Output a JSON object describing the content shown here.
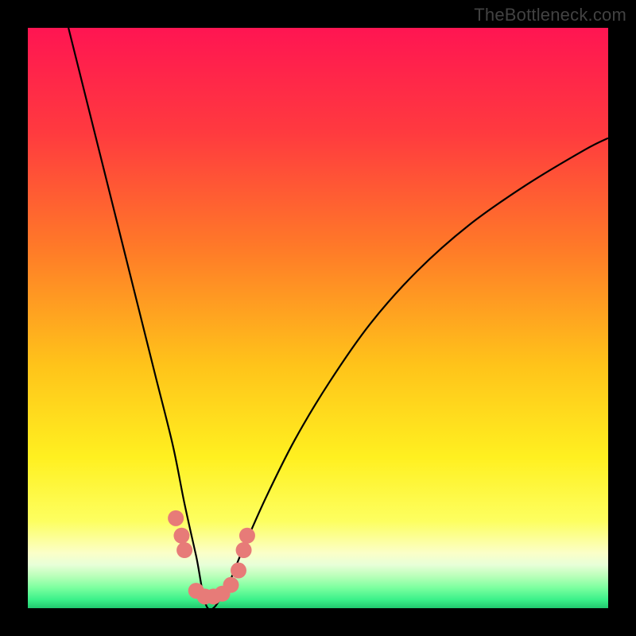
{
  "chart_data": {
    "type": "line",
    "title": "",
    "xlabel": "",
    "ylabel": "",
    "x_range": [
      0,
      100
    ],
    "y_range": [
      0,
      100
    ],
    "bottleneck_min_x": 31,
    "series": [
      {
        "name": "bottleneck-curve",
        "x": [
          7,
          10,
          13,
          16,
          19,
          22,
          25,
          27,
          29,
          31,
          34,
          37,
          41,
          46,
          52,
          59,
          67,
          76,
          86,
          96,
          100
        ],
        "y": [
          100,
          88,
          76,
          64,
          52,
          40,
          28,
          18,
          9,
          0,
          3,
          10,
          19,
          29,
          39,
          49,
          58,
          66,
          73,
          79,
          81
        ]
      }
    ],
    "markers": {
      "name": "highlight-dots",
      "color": "#e77b78",
      "points": [
        {
          "x": 25.5,
          "y": 15.5
        },
        {
          "x": 26.5,
          "y": 12.5
        },
        {
          "x": 27.0,
          "y": 10.0
        },
        {
          "x": 29.0,
          "y": 3.0
        },
        {
          "x": 30.5,
          "y": 2.0
        },
        {
          "x": 32.0,
          "y": 2.0
        },
        {
          "x": 33.5,
          "y": 2.5
        },
        {
          "x": 35.0,
          "y": 4.0
        },
        {
          "x": 36.3,
          "y": 6.5
        },
        {
          "x": 37.2,
          "y": 10.0
        },
        {
          "x": 37.8,
          "y": 12.5
        }
      ]
    },
    "gradient_stops": [
      {
        "offset": 0.0,
        "color": "#ff1552"
      },
      {
        "offset": 0.18,
        "color": "#ff3a3f"
      },
      {
        "offset": 0.38,
        "color": "#ff7a28"
      },
      {
        "offset": 0.58,
        "color": "#ffc31a"
      },
      {
        "offset": 0.74,
        "color": "#fff020"
      },
      {
        "offset": 0.85,
        "color": "#fdff60"
      },
      {
        "offset": 0.905,
        "color": "#fbffc8"
      },
      {
        "offset": 0.925,
        "color": "#e8ffd8"
      },
      {
        "offset": 0.945,
        "color": "#b9ffb9"
      },
      {
        "offset": 0.965,
        "color": "#7bff9f"
      },
      {
        "offset": 0.985,
        "color": "#3cf18a"
      },
      {
        "offset": 1.0,
        "color": "#21c96f"
      }
    ]
  },
  "watermark": "TheBottleneck.com"
}
